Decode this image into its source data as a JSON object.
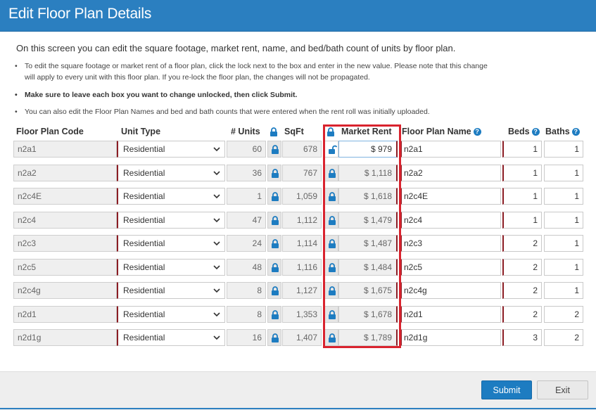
{
  "title": "Edit Floor Plan Details",
  "intro": "On this screen you can edit the square footage, market rent, name, and bed/bath count of units by floor plan.",
  "bullets": [
    "To edit the square footage or market rent of a floor plan, click the lock next to the box and enter in the new value. Please note that this change will apply to every unit with this floor plan. If you re-lock the floor plan, the changes will not be propagated.",
    "Make sure to leave each box you want to change unlocked, then click Submit.",
    "You can also edit the Floor Plan Names and bed and bath counts that were entered when the rent roll was initially uploaded."
  ],
  "headers": {
    "code": "Floor Plan Code",
    "unit_type": "Unit Type",
    "units": "# Units",
    "sqft": "SqFt",
    "market_rent": "Market Rent",
    "plan_name": "Floor Plan Name",
    "beds": "Beds",
    "baths": "Baths"
  },
  "rows": [
    {
      "code": "n2a1",
      "unit_type": "Residential",
      "units": "60",
      "sqft": "678",
      "rent": "$ 979",
      "name": "n2a1",
      "beds": "1",
      "baths": "1"
    },
    {
      "code": "n2a2",
      "unit_type": "Residential",
      "units": "36",
      "sqft": "767",
      "rent": "$ 1,118",
      "name": "n2a2",
      "beds": "1",
      "baths": "1"
    },
    {
      "code": "n2c4E",
      "unit_type": "Residential",
      "units": "1",
      "sqft": "1,059",
      "rent": "$ 1,618",
      "name": "n2c4E",
      "beds": "1",
      "baths": "1"
    },
    {
      "code": "n2c4",
      "unit_type": "Residential",
      "units": "47",
      "sqft": "1,112",
      "rent": "$ 1,479",
      "name": "n2c4",
      "beds": "1",
      "baths": "1"
    },
    {
      "code": "n2c3",
      "unit_type": "Residential",
      "units": "24",
      "sqft": "1,114",
      "rent": "$ 1,487",
      "name": "n2c3",
      "beds": "2",
      "baths": "1"
    },
    {
      "code": "n2c5",
      "unit_type": "Residential",
      "units": "48",
      "sqft": "1,116",
      "rent": "$ 1,484",
      "name": "n2c5",
      "beds": "2",
      "baths": "1"
    },
    {
      "code": "n2c4g",
      "unit_type": "Residential",
      "units": "8",
      "sqft": "1,127",
      "rent": "$ 1,675",
      "name": "n2c4g",
      "beds": "2",
      "baths": "1"
    },
    {
      "code": "n2d1",
      "unit_type": "Residential",
      "units": "8",
      "sqft": "1,353",
      "rent": "$ 1,678",
      "name": "n2d1",
      "beds": "2",
      "baths": "2"
    },
    {
      "code": "n2d1g",
      "unit_type": "Residential",
      "units": "16",
      "sqft": "1,407",
      "rent": "$ 1,789",
      "name": "n2d1g",
      "beds": "3",
      "baths": "2"
    }
  ],
  "buttons": {
    "submit": "Submit",
    "exit": "Exit"
  },
  "colors": {
    "brand": "#2b7fc0",
    "required": "#8c1d24",
    "highlight": "#d9232e",
    "lock": "#1d7cc1"
  }
}
